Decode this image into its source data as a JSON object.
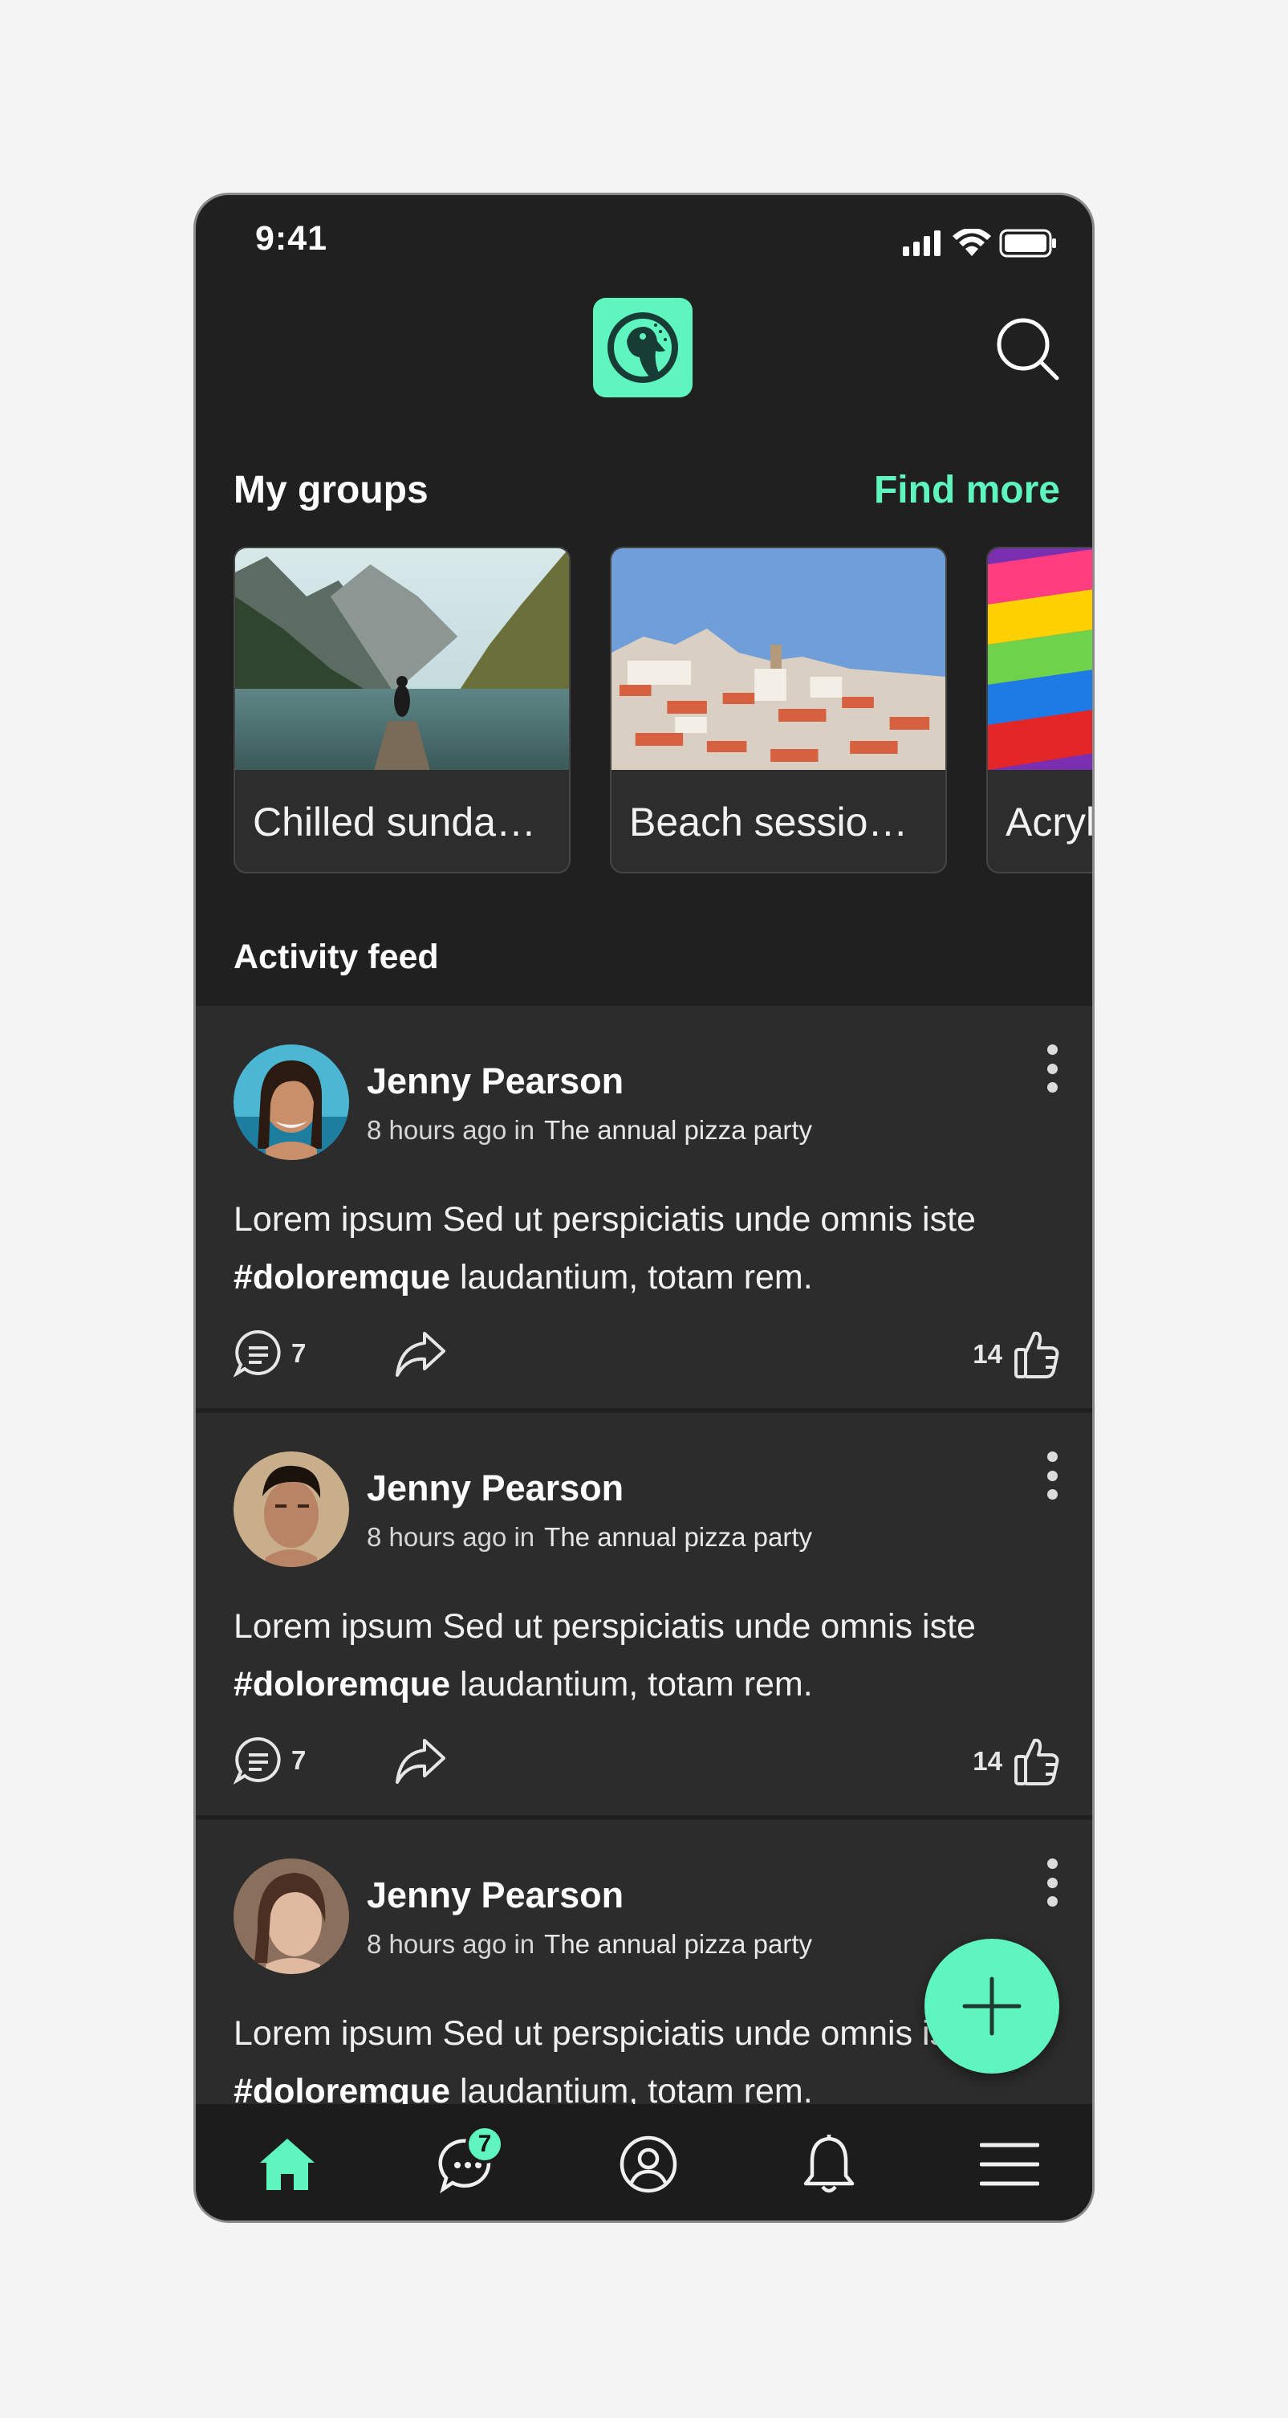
{
  "status_bar": {
    "time": "9:41"
  },
  "header": {
    "logo": "bird-logo-icon",
    "search": "search-icon"
  },
  "groups": {
    "title": "My groups",
    "find_more": "Find more",
    "items": [
      {
        "label": "Chilled sunda…"
      },
      {
        "label": "Beach sessio…"
      },
      {
        "label": "Acryl"
      }
    ]
  },
  "feed": {
    "title": "Activity feed",
    "posts": [
      {
        "author": "Jenny Pearson",
        "time": "8 hours ago in",
        "group": "The annual pizza party",
        "text": "Lorem ipsum Sed ut perspiciatis unde omnis iste",
        "hashtag": "#doloremque",
        "text_after": " laudantium, totam rem.",
        "comments": "7",
        "likes": "14"
      },
      {
        "author": "Jenny Pearson",
        "time": "8 hours ago in",
        "group": "The annual pizza party",
        "text": "Lorem ipsum Sed ut perspiciatis unde omnis iste",
        "hashtag": "#doloremque",
        "text_after": " laudantium, totam rem.",
        "comments": "7",
        "likes": "14"
      },
      {
        "author": "Jenny Pearson",
        "time": "8 hours ago in",
        "group": "The annual pizza party",
        "text": "Lorem ipsum Sed ut perspiciatis unde omnis iste",
        "hashtag": "#doloremque",
        "text_after": " laudantium, totam rem.",
        "comments": "",
        "likes": ""
      }
    ]
  },
  "tab_bar": {
    "messages_badge": "7",
    "tabs": [
      "home-icon",
      "messages-icon",
      "profile-icon",
      "notifications-icon",
      "menu-icon"
    ]
  },
  "colors": {
    "accent": "#5ff5bf",
    "background": "#202020",
    "card": "#2c2c2c"
  }
}
